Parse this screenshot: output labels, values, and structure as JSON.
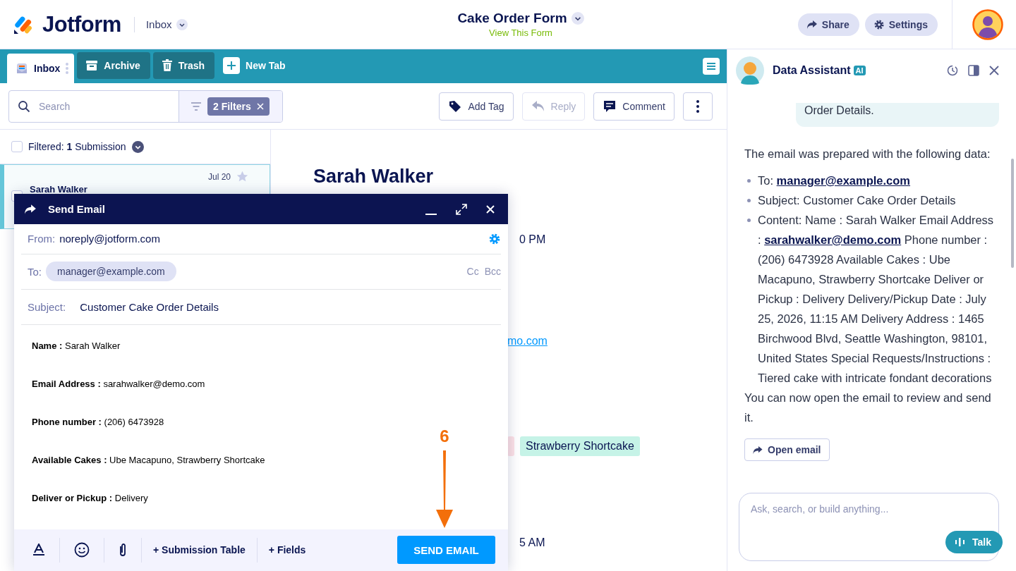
{
  "header": {
    "brand": "Jotform",
    "inbox_menu": "Inbox",
    "form_title": "Cake Order Form",
    "form_link": "View This Form",
    "buttons": [
      {
        "label": "Share",
        "kind": "share"
      },
      {
        "label": "Settings",
        "kind": "settings"
      }
    ]
  },
  "tabs": [
    {
      "label": "Inbox",
      "kind": "inbox",
      "selected": true
    },
    {
      "label": "Archive",
      "kind": "archive",
      "selected": false
    },
    {
      "label": "Trash",
      "kind": "trash",
      "selected": false
    }
  ],
  "new_tab": "New Tab",
  "toolbar": {
    "search": {
      "placeholder": "Search"
    },
    "filter_chip": "2 Filters",
    "actions": [
      {
        "label": "Add Tag",
        "kind": "tag",
        "disabled": false
      },
      {
        "label": "Reply",
        "kind": "reply",
        "disabled": true
      },
      {
        "label": "Comment",
        "kind": "comment",
        "disabled": false
      }
    ]
  },
  "list": {
    "filtered_label": "Filtered: **1** Submission",
    "select_all_checked": false,
    "items": [
      {
        "name": "Sarah Walker",
        "date": "Jul 20",
        "starred": false,
        "selected": true
      }
    ]
  },
  "detail": {
    "name": "Sarah Walker",
    "time_1": "0 PM",
    "link": "mo.com",
    "tags": [
      {
        "color": "#fde1e6"
      },
      {
        "label": "Strawberry Shortcake",
        "color": "#c6f3e7"
      }
    ],
    "time_2": "5 AM"
  },
  "email_modal": {
    "title": "Send Email",
    "from_label": "From:",
    "from": "noreply@jotform.com",
    "to_label": "To:",
    "to": "manager@example.com",
    "cc": "Cc",
    "bcc": "Bcc",
    "subject_label": "Subject:",
    "subject": "Customer Cake Order Details",
    "body": [
      "**Name :** Sarah Walker",
      "**Email Address :** sarahwalker@demo.com",
      "**Phone number :** (206) 6473928",
      "**Available Cakes :** Ube Macapuno, Strawberry Shortcake",
      "**Deliver or Pickup :** Delivery"
    ],
    "insert_buttons": [
      "+ Submission Table",
      "+ Fields"
    ],
    "send": "SEND EMAIL"
  },
  "annotation": {
    "step": "6"
  },
  "assistant": {
    "title": "Data Assistant",
    "badge": "AI",
    "bubble": "Order Details.",
    "intro": "The email was prepared with the following data:",
    "bullets": [
      "To: **manager@example.com**",
      "Subject: Customer Cake Order Details",
      "Content: Name : Sarah Walker Email Address : **sarahwalker@demo.com** Phone number : (206) 6473928 Available Cakes : Ube Macapuno, Strawberry Shortcake Deliver or Pickup : Delivery Delivery/Pickup Date : July 25, 2026, 11:15 AM Delivery Address : 1465 Birchwood Blvd, Seattle Washington, 98101, United States Special Requests/Instructions : Tiered cake with intricate fondant decorations"
    ],
    "outro": "You can now open the email to review and send it.",
    "open_button": "Open email",
    "input": {
      "placeholder": "Ask, search, or build anything..."
    },
    "talk": "Talk"
  }
}
